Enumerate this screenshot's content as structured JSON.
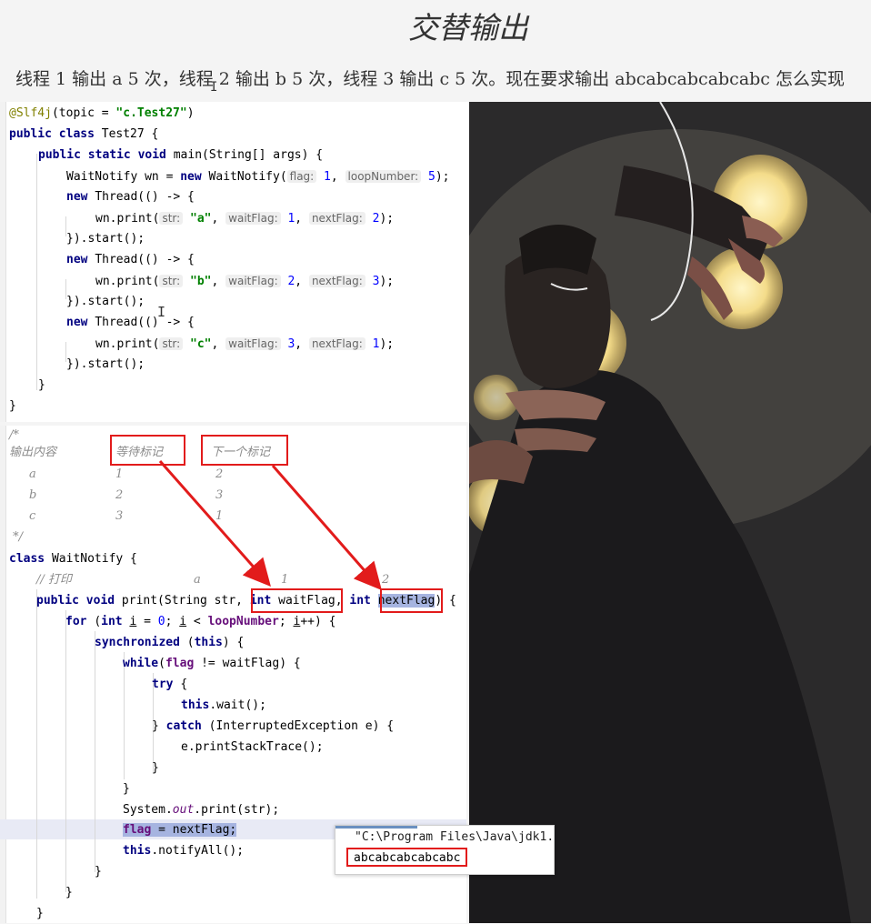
{
  "slide": {
    "title": "交替输出",
    "description": "线程 1 输出 a 5 次，线程 2 输出 b 5 次，线程 3 输出 c 5 次。现在要求输出 abcabcabcabcabc 怎么实现"
  },
  "code_top": {
    "l1": {
      "ann": "@Slf4j",
      "a": "(topic = ",
      "s": "\"c.Test27\"",
      "b": ")"
    },
    "l2": {
      "k": "public class ",
      "t": "Test27 {"
    },
    "l3": {
      "k": "public static void ",
      "t": "main(String[] args) {"
    },
    "l4": {
      "t1": "WaitNotify wn = ",
      "k": "new ",
      "t2": "WaitNotify(",
      "h1": "flag:",
      "n1": "1",
      "c1": ", ",
      "h2": "loopNumber:",
      "n2": "5",
      "t3": ");"
    },
    "threads": [
      {
        "k": "new ",
        "t": "Thread(() -> {",
        "call": "wn.print(",
        "h1": "str:",
        "s": "\"a\"",
        "h2": "waitFlag:",
        "n1": "1",
        "h3": "nextFlag:",
        "n2": "2",
        "end": ");",
        "start": "}).start();"
      },
      {
        "k": "new ",
        "t": "Thread(() -> {",
        "call": "wn.print(",
        "h1": "str:",
        "s": "\"b\"",
        "h2": "waitFlag:",
        "n1": "2",
        "h3": "nextFlag:",
        "n2": "3",
        "end": ");",
        "start": "}).start();"
      },
      {
        "k": "new ",
        "t": "Thread(() -> {",
        "call": "wn.print(",
        "h1": "str:",
        "s": "\"c\"",
        "h2": "waitFlag:",
        "n1": "3",
        "h3": "nextFlag:",
        "n2": "1",
        "end": ");",
        "start": "}).start();"
      }
    ],
    "close_method": "}",
    "close_class": "}"
  },
  "code_bottom": {
    "c_open": "/*",
    "c_header": [
      "输出内容",
      "等待标记",
      "下一个标记"
    ],
    "c_rows": [
      [
        "a",
        "1",
        "2"
      ],
      [
        "b",
        "2",
        "3"
      ],
      [
        "c",
        "3",
        "1"
      ]
    ],
    "c_close": " */",
    "class_kw": "class ",
    "class_name": "WaitNotify {",
    "print_comment": "// 打印",
    "print_comment_a": "a",
    "print_comment_1": "1",
    "print_comment_2": "2",
    "sig": {
      "k1": "public void ",
      "t1": "print(String str, ",
      "k2": "int ",
      "p1": "waitFlag",
      "c": ", ",
      "k3": "int ",
      "p2": "nextFlag",
      "end": ") {"
    },
    "for": {
      "k1": "for ",
      "t1": "(",
      "k2": "int ",
      "i1": "i",
      "t2": " = ",
      "n0": "0",
      "t3": "; ",
      "i2": "i",
      "t4": " < ",
      "f": "loopNumber",
      "t5": "; ",
      "i3": "i",
      "t6": "++) {"
    },
    "sync": {
      "k": "synchronized ",
      "t1": "(",
      "k2": "this",
      "t2": ") {"
    },
    "while": {
      "k": "while",
      "t1": "(",
      "f": "flag",
      "t2": " != waitFlag) {"
    },
    "try": {
      "k": "try ",
      "t": "{"
    },
    "wait": {
      "k": "this",
      "t": ".wait();"
    },
    "catch": {
      "t1": "} ",
      "k": "catch ",
      "t2": "(InterruptedException e) {"
    },
    "trace": "e.printStackTrace();",
    "close_catch": "}",
    "close_while": "}",
    "sysout": {
      "t1": "System.",
      "st": "out",
      "t2": ".print(str);"
    },
    "assign": {
      "f": "flag",
      "t": " = nextFlag;"
    },
    "notify": {
      "k": "this",
      "t": ".notifyAll();"
    },
    "close_sync": "}",
    "close_for": "}",
    "close_method": "}"
  },
  "console": {
    "path": "\"C:\\Program Files\\Java\\jdk1.",
    "output": "abcabcabcabcabc"
  },
  "colors": {
    "highlight_box": "#e21b1b",
    "keyword": "#000080",
    "string": "#008000"
  }
}
